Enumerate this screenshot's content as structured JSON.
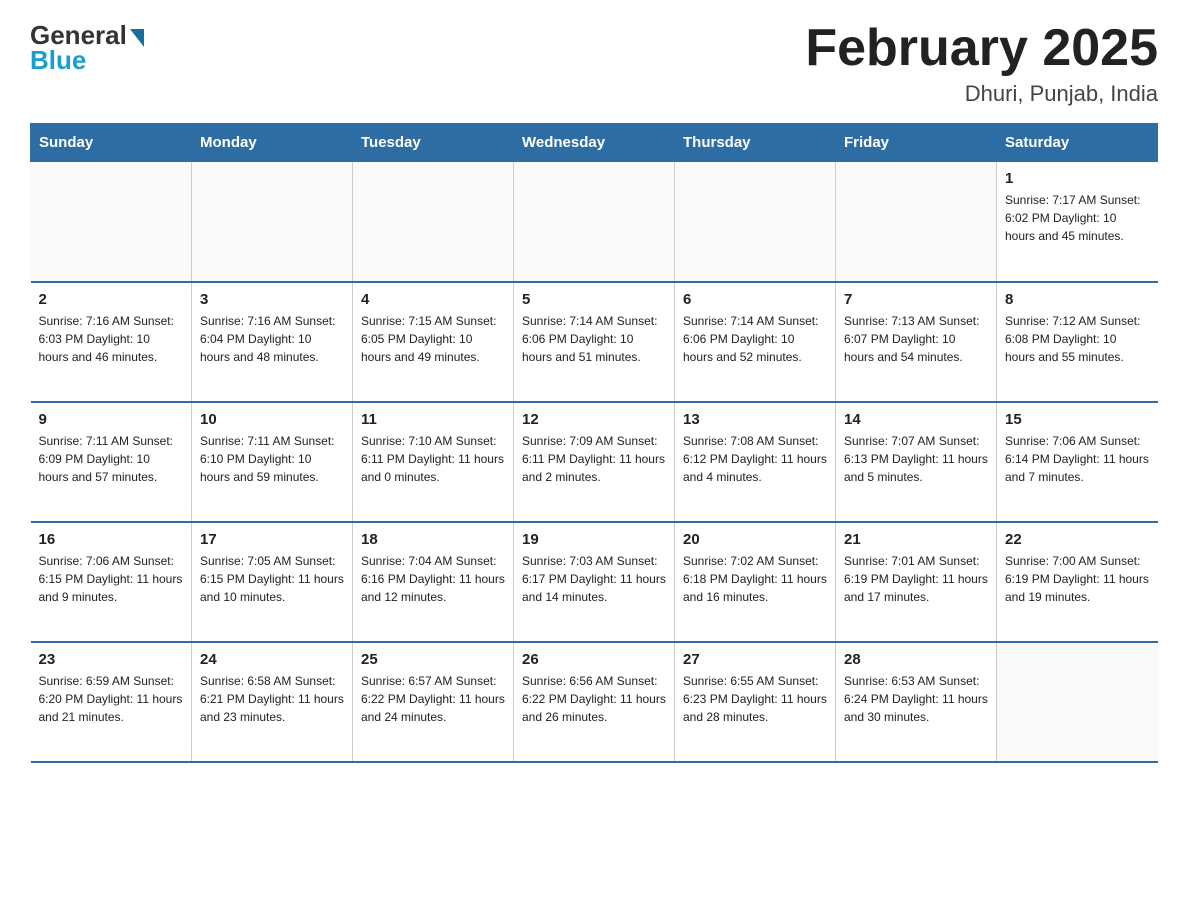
{
  "logo": {
    "general": "General",
    "blue": "Blue"
  },
  "header": {
    "month_year": "February 2025",
    "location": "Dhuri, Punjab, India"
  },
  "days_of_week": [
    "Sunday",
    "Monday",
    "Tuesday",
    "Wednesday",
    "Thursday",
    "Friday",
    "Saturday"
  ],
  "weeks": [
    [
      {
        "day": "",
        "info": ""
      },
      {
        "day": "",
        "info": ""
      },
      {
        "day": "",
        "info": ""
      },
      {
        "day": "",
        "info": ""
      },
      {
        "day": "",
        "info": ""
      },
      {
        "day": "",
        "info": ""
      },
      {
        "day": "1",
        "info": "Sunrise: 7:17 AM\nSunset: 6:02 PM\nDaylight: 10 hours and 45 minutes."
      }
    ],
    [
      {
        "day": "2",
        "info": "Sunrise: 7:16 AM\nSunset: 6:03 PM\nDaylight: 10 hours and 46 minutes."
      },
      {
        "day": "3",
        "info": "Sunrise: 7:16 AM\nSunset: 6:04 PM\nDaylight: 10 hours and 48 minutes."
      },
      {
        "day": "4",
        "info": "Sunrise: 7:15 AM\nSunset: 6:05 PM\nDaylight: 10 hours and 49 minutes."
      },
      {
        "day": "5",
        "info": "Sunrise: 7:14 AM\nSunset: 6:06 PM\nDaylight: 10 hours and 51 minutes."
      },
      {
        "day": "6",
        "info": "Sunrise: 7:14 AM\nSunset: 6:06 PM\nDaylight: 10 hours and 52 minutes."
      },
      {
        "day": "7",
        "info": "Sunrise: 7:13 AM\nSunset: 6:07 PM\nDaylight: 10 hours and 54 minutes."
      },
      {
        "day": "8",
        "info": "Sunrise: 7:12 AM\nSunset: 6:08 PM\nDaylight: 10 hours and 55 minutes."
      }
    ],
    [
      {
        "day": "9",
        "info": "Sunrise: 7:11 AM\nSunset: 6:09 PM\nDaylight: 10 hours and 57 minutes."
      },
      {
        "day": "10",
        "info": "Sunrise: 7:11 AM\nSunset: 6:10 PM\nDaylight: 10 hours and 59 minutes."
      },
      {
        "day": "11",
        "info": "Sunrise: 7:10 AM\nSunset: 6:11 PM\nDaylight: 11 hours and 0 minutes."
      },
      {
        "day": "12",
        "info": "Sunrise: 7:09 AM\nSunset: 6:11 PM\nDaylight: 11 hours and 2 minutes."
      },
      {
        "day": "13",
        "info": "Sunrise: 7:08 AM\nSunset: 6:12 PM\nDaylight: 11 hours and 4 minutes."
      },
      {
        "day": "14",
        "info": "Sunrise: 7:07 AM\nSunset: 6:13 PM\nDaylight: 11 hours and 5 minutes."
      },
      {
        "day": "15",
        "info": "Sunrise: 7:06 AM\nSunset: 6:14 PM\nDaylight: 11 hours and 7 minutes."
      }
    ],
    [
      {
        "day": "16",
        "info": "Sunrise: 7:06 AM\nSunset: 6:15 PM\nDaylight: 11 hours and 9 minutes."
      },
      {
        "day": "17",
        "info": "Sunrise: 7:05 AM\nSunset: 6:15 PM\nDaylight: 11 hours and 10 minutes."
      },
      {
        "day": "18",
        "info": "Sunrise: 7:04 AM\nSunset: 6:16 PM\nDaylight: 11 hours and 12 minutes."
      },
      {
        "day": "19",
        "info": "Sunrise: 7:03 AM\nSunset: 6:17 PM\nDaylight: 11 hours and 14 minutes."
      },
      {
        "day": "20",
        "info": "Sunrise: 7:02 AM\nSunset: 6:18 PM\nDaylight: 11 hours and 16 minutes."
      },
      {
        "day": "21",
        "info": "Sunrise: 7:01 AM\nSunset: 6:19 PM\nDaylight: 11 hours and 17 minutes."
      },
      {
        "day": "22",
        "info": "Sunrise: 7:00 AM\nSunset: 6:19 PM\nDaylight: 11 hours and 19 minutes."
      }
    ],
    [
      {
        "day": "23",
        "info": "Sunrise: 6:59 AM\nSunset: 6:20 PM\nDaylight: 11 hours and 21 minutes."
      },
      {
        "day": "24",
        "info": "Sunrise: 6:58 AM\nSunset: 6:21 PM\nDaylight: 11 hours and 23 minutes."
      },
      {
        "day": "25",
        "info": "Sunrise: 6:57 AM\nSunset: 6:22 PM\nDaylight: 11 hours and 24 minutes."
      },
      {
        "day": "26",
        "info": "Sunrise: 6:56 AM\nSunset: 6:22 PM\nDaylight: 11 hours and 26 minutes."
      },
      {
        "day": "27",
        "info": "Sunrise: 6:55 AM\nSunset: 6:23 PM\nDaylight: 11 hours and 28 minutes."
      },
      {
        "day": "28",
        "info": "Sunrise: 6:53 AM\nSunset: 6:24 PM\nDaylight: 11 hours and 30 minutes."
      },
      {
        "day": "",
        "info": ""
      }
    ]
  ]
}
